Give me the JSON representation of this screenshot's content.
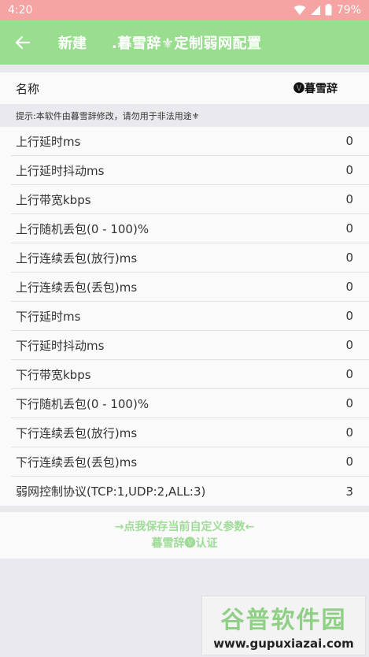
{
  "status": {
    "time": "4:20",
    "battery": "79%"
  },
  "appbar": {
    "title": "新建",
    "subtitle": ".暮雪辞⚜定制弱网配置"
  },
  "name_row": {
    "label": "名称",
    "value": "🅥暮雪辞"
  },
  "hint": "提示:本软件由暮雪辞修改，请勿用于非法用途⚜",
  "settings": [
    {
      "label": "上行延时ms",
      "value": "0"
    },
    {
      "label": "上行延时抖动ms",
      "value": "0"
    },
    {
      "label": "上行带宽kbps",
      "value": "0"
    },
    {
      "label": "上行随机丢包(0 - 100)%",
      "value": "0"
    },
    {
      "label": "上行连续丢包(放行)ms",
      "value": "0"
    },
    {
      "label": "上行连续丢包(丢包)ms",
      "value": "0"
    },
    {
      "label": "下行延时ms",
      "value": "0"
    },
    {
      "label": "下行延时抖动ms",
      "value": "0"
    },
    {
      "label": "下行带宽kbps",
      "value": "0"
    },
    {
      "label": "下行随机丢包(0 - 100)%",
      "value": "0"
    },
    {
      "label": "下行连续丢包(放行)ms",
      "value": "0"
    },
    {
      "label": "下行连续丢包(丢包)ms",
      "value": "0"
    },
    {
      "label": "弱网控制协议(TCP:1,UDP:2,ALL:3)",
      "value": "3"
    }
  ],
  "footer": {
    "line1": "→点我保存当前自定义参数←",
    "line2": "暮雪辞🅥认证"
  },
  "watermark": {
    "big": "谷普软件园",
    "small": "www.gupuxiazai.com"
  },
  "colors": {
    "statusbar": "#f5a3a3",
    "appbar": "#99de8f",
    "accent": "#9edc97"
  }
}
